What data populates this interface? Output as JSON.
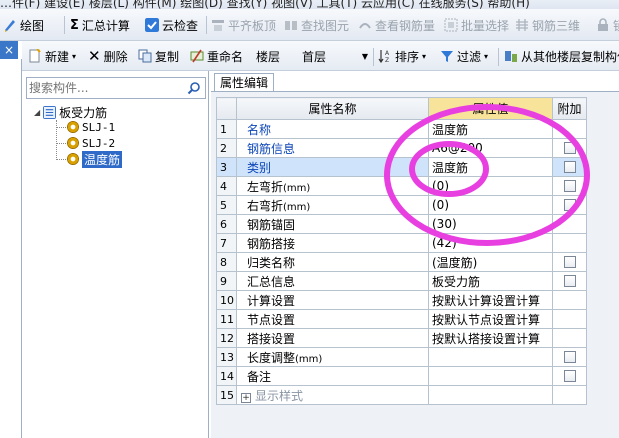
{
  "menu": {
    "partial_text": "…件(F)   建设(E)   楼层(L)   构件(M)   绘图(D)   查找(Y)   视图(V)   工具(T)   云应用(C)   在线服务(S)   帮助(H)"
  },
  "toolbar1": {
    "items": [
      {
        "label": "绘图",
        "icon": "draw-icon",
        "enabled": true
      },
      {
        "label": "汇总计算",
        "icon": "sigma-icon",
        "enabled": true
      },
      {
        "label": "云检查",
        "icon": "cloud-check-icon",
        "enabled": true
      },
      {
        "label": "平齐板顶",
        "icon": "align-top-icon",
        "enabled": false
      },
      {
        "label": "查找图元",
        "icon": "find-element-icon",
        "enabled": false
      },
      {
        "label": "查看钢筋量",
        "icon": "view-rebar-icon",
        "enabled": false
      },
      {
        "label": "批量选择",
        "icon": "batch-select-icon",
        "enabled": false
      },
      {
        "label": "钢筋三维",
        "icon": "rebar-3d-icon",
        "enabled": false
      },
      {
        "label": "锁",
        "icon": "lock-icon",
        "enabled": false
      }
    ],
    "sigma_glyph": "Σ"
  },
  "left_panel": {
    "close_glyph": "×",
    "search_placeholder": "搜索构件...",
    "tree": {
      "root": "板受力筋",
      "children": [
        "SLJ-1",
        "SLJ-2",
        "温度筋"
      ],
      "selected": "温度筋"
    }
  },
  "toolbar2": {
    "new_label": "新建",
    "delete_label": "删除",
    "copy_label": "复制",
    "rename_label": "重命名",
    "floor_label": "楼层",
    "floor_value": "首层",
    "sort_label": "排序",
    "filter_label": "过滤",
    "copy_from_floor_label": "从其他楼层复制构件"
  },
  "property_panel": {
    "tab_label": "属性编辑",
    "columns": {
      "name": "属性名称",
      "value": "属性值",
      "extra": "附加"
    },
    "rows": [
      {
        "num": "1",
        "name": "名称",
        "unit": "",
        "value": "温度筋",
        "checkbox": false,
        "style": "blue"
      },
      {
        "num": "2",
        "name": "钢筋信息",
        "unit": "",
        "value": "A6@200",
        "checkbox": true,
        "style": "blue"
      },
      {
        "num": "3",
        "name": "类别",
        "unit": "",
        "value": "温度筋",
        "checkbox": true,
        "style": "blue",
        "selected": true
      },
      {
        "num": "4",
        "name": "左弯折",
        "unit": "(mm)",
        "value": "(0)",
        "checkbox": true,
        "style": "black"
      },
      {
        "num": "5",
        "name": "右弯折",
        "unit": "(mm)",
        "value": "(0)",
        "checkbox": true,
        "style": "black"
      },
      {
        "num": "6",
        "name": "钢筋锚固",
        "unit": "",
        "value": "(30)",
        "checkbox": false,
        "style": "black"
      },
      {
        "num": "7",
        "name": "钢筋搭接",
        "unit": "",
        "value": "(42)",
        "checkbox": false,
        "style": "black"
      },
      {
        "num": "8",
        "name": "归类名称",
        "unit": "",
        "value": "(温度筋)",
        "checkbox": true,
        "style": "black"
      },
      {
        "num": "9",
        "name": "汇总信息",
        "unit": "",
        "value": "板受力筋",
        "checkbox": true,
        "style": "black"
      },
      {
        "num": "10",
        "name": "计算设置",
        "unit": "",
        "value": "按默认计算设置计算",
        "checkbox": false,
        "style": "black"
      },
      {
        "num": "11",
        "name": "节点设置",
        "unit": "",
        "value": "按默认节点设置计算",
        "checkbox": false,
        "style": "black"
      },
      {
        "num": "12",
        "name": "搭接设置",
        "unit": "",
        "value": "按默认搭接设置计算",
        "checkbox": false,
        "style": "black"
      },
      {
        "num": "13",
        "name": "长度调整",
        "unit": "(mm)",
        "value": "",
        "checkbox": true,
        "style": "black"
      },
      {
        "num": "14",
        "name": "备注",
        "unit": "",
        "value": "",
        "checkbox": true,
        "style": "black"
      },
      {
        "num": "15",
        "name": "显示样式",
        "unit": "",
        "value": "",
        "checkbox": false,
        "style": "gray",
        "expandable": true,
        "expand_glyph": "+"
      }
    ]
  },
  "annotation": {
    "color": "#e83fe0"
  }
}
